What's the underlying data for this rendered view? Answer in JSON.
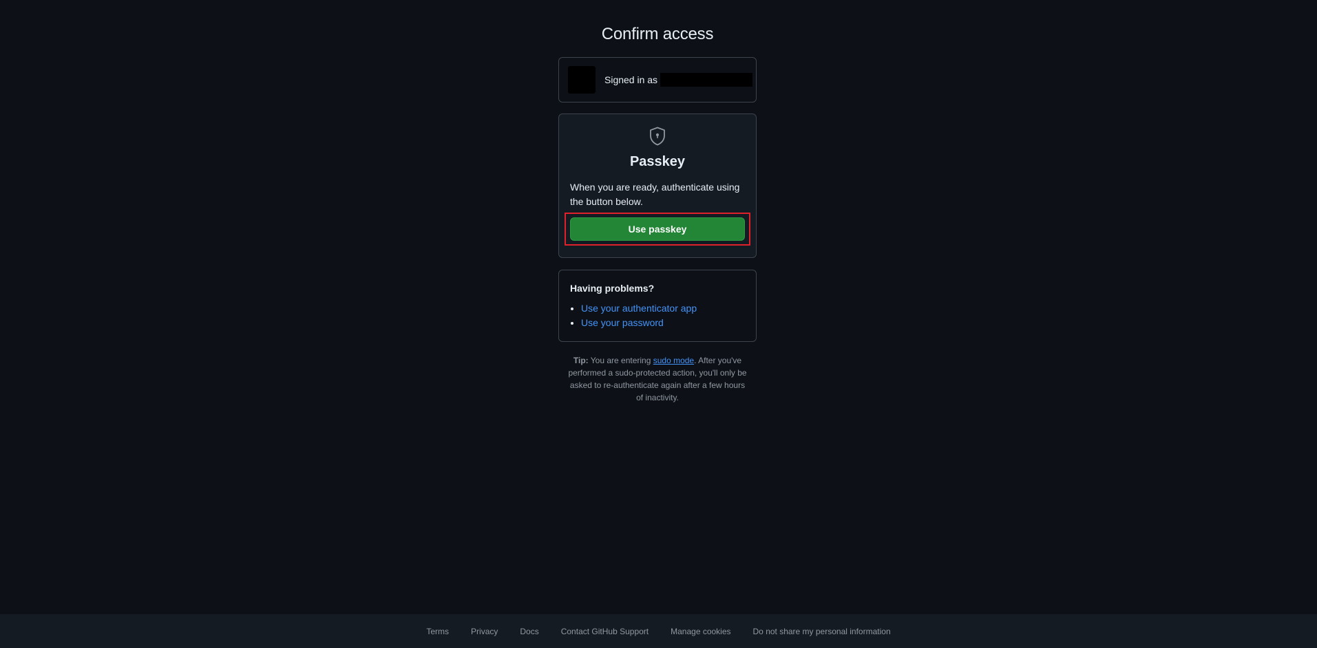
{
  "page": {
    "title": "Confirm access"
  },
  "signed_in": {
    "label": "Signed in as"
  },
  "passkey": {
    "icon": "shield-lock-icon",
    "title": "Passkey",
    "description": "When you are ready, authenticate using the button below.",
    "button_label": "Use passkey",
    "button_color": "#238636",
    "highlight_color": "#e0202a"
  },
  "problems": {
    "title": "Having problems?",
    "links": [
      "Use your authenticator app",
      "Use your password"
    ]
  },
  "tip": {
    "label": "Tip:",
    "text_before": " You are entering ",
    "link": "sudo mode",
    "text_after": ". After you've performed a sudo-protected action, you'll only be asked to re-authenticate again after a few hours of inactivity."
  },
  "footer": {
    "links": [
      "Terms",
      "Privacy",
      "Docs",
      "Contact GitHub Support",
      "Manage cookies",
      "Do not share my personal information"
    ]
  }
}
